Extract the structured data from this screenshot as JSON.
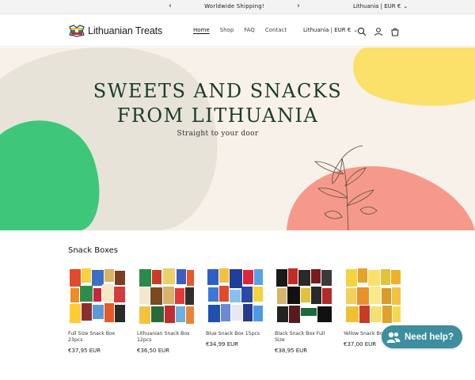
{
  "announcement": {
    "message": "Worldwide Shipping!",
    "locale": "Lithuania | EUR €"
  },
  "header": {
    "brand": "Lithuanian Treats",
    "nav": [
      {
        "label": "Home",
        "active": true
      },
      {
        "label": "Shop",
        "active": false
      },
      {
        "label": "FAQ",
        "active": false
      },
      {
        "label": "Contact",
        "active": false
      }
    ],
    "locale": "Lithuania | EUR €",
    "icons": [
      "search-icon",
      "account-icon",
      "cart-icon"
    ]
  },
  "hero": {
    "title_line1": "SWEETS AND SNACKS",
    "title_line2": "FROM LITHUANIA",
    "subtitle": "Straight to your door",
    "colors": {
      "bg": "#f8f1e9",
      "green": "#3ec77a",
      "yellow": "#fbe06a",
      "salmon": "#f59a8a",
      "grey": "#e7e3d8"
    }
  },
  "section": {
    "title": "Snack Boxes"
  },
  "products": [
    {
      "name": "Full Size Snack Box 23pcs",
      "price": "€37,95 EUR"
    },
    {
      "name": "Lithuanian Snack Box 12pcs",
      "price": "€36,50 EUR"
    },
    {
      "name": "Blue Snack Box 15pcs",
      "price": "€34,99 EUR"
    },
    {
      "name": "Black Snack Box Full Size",
      "price": "€38,95 EUR"
    },
    {
      "name": "Yellow Snack Box",
      "price": "€37,00 EUR"
    }
  ],
  "chat": {
    "label": "Need help?",
    "color": "#3d8e9e"
  }
}
